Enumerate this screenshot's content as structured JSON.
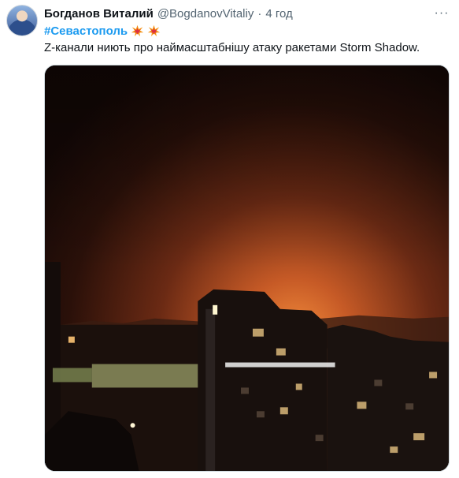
{
  "tweet": {
    "author_name": "Богданов Виталий",
    "author_handle": "@BogdanovVitaliy",
    "separator": "·",
    "time": "4 год",
    "more_label": "···",
    "hashtag": "#Севастополь",
    "text": "Z-канали ниють про наймасштабнішу атаку ракетами Storm Shadow.",
    "emojis": [
      "collision-emoji",
      "collision-emoji"
    ]
  },
  "colors": {
    "link": "#1d9bf0",
    "secondary_text": "#536471",
    "sky_glow": "#e2702c"
  }
}
